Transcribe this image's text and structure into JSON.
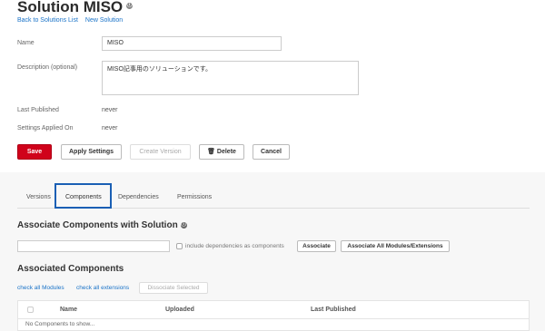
{
  "header": {
    "title": "Solution MISO",
    "info_icon": "ⓘ",
    "back_link": "Back to Solutions List",
    "new_link": "New Solution"
  },
  "form": {
    "name_label": "Name",
    "name_value": "MISO",
    "description_label": "Description (optional)",
    "description_value": "MISO記事用のソリューションです。",
    "last_published_label": "Last Published",
    "last_published_value": "never",
    "settings_applied_label": "Settings Applied On",
    "settings_applied_value": "never"
  },
  "actions": {
    "save": "Save",
    "apply_settings": "Apply Settings",
    "create_version": "Create Version",
    "delete": "Delete",
    "cancel": "Cancel"
  },
  "tabs": {
    "versions": "Versions",
    "components": "Components",
    "dependencies": "Dependencies",
    "permissions": "Permissions",
    "active": "components"
  },
  "associate": {
    "heading": "Associate Components with Solution",
    "search_value": "",
    "include_deps_label": "include dependencies as components",
    "associate_button": "Associate",
    "associate_all_button": "Associate All Modules/Extensions"
  },
  "associated": {
    "heading": "Associated Components",
    "check_modules": "check all Modules",
    "check_extensions": "check all extensions",
    "dissociate_button": "Dissociate Selected",
    "columns": [
      "Name",
      "Uploaded",
      "Last Published"
    ],
    "empty_text": "No Components to show..."
  },
  "colors": {
    "accent": "#d0021b",
    "link": "#1a73c8",
    "highlight": "#1a5fb4"
  }
}
